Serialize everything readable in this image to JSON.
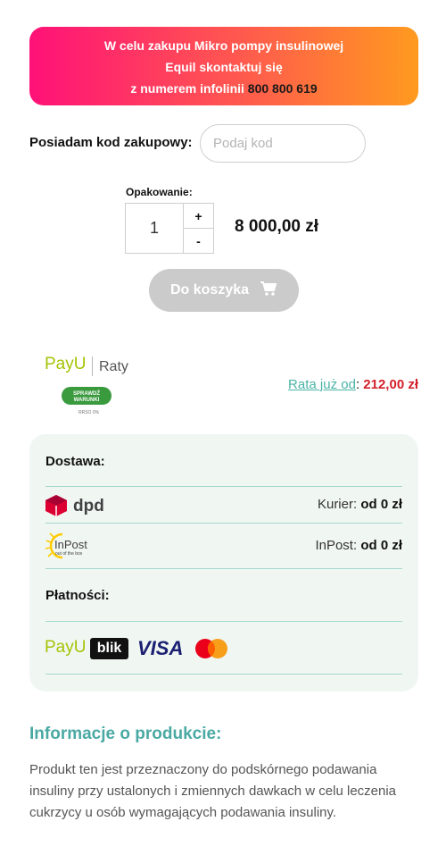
{
  "banner": {
    "line1": "W celu zakupu Mikro pompy insulinowej",
    "line2": "Equil skontaktuj się",
    "line3_prefix": "z numerem infolinii",
    "phone": "800 800 619"
  },
  "purchase_code": {
    "label": "Posiadam kod zakupowy:",
    "placeholder": "Podaj kod",
    "value": ""
  },
  "quantity": {
    "label": "Opakowanie:",
    "value": "1",
    "plus": "+",
    "minus": "-"
  },
  "price": "8 000,00 zł",
  "cart_button": {
    "label": "Do koszyka",
    "icon": "cart-icon"
  },
  "payu_raty": {
    "logo": "PayU",
    "raty": "Raty",
    "check_button": "SPRAWDŹ WARUNKI",
    "rrso": "RRSO 0%",
    "rate_link": "Rata już od",
    "rate_sep": ":",
    "rate_value": "212,00 zł"
  },
  "delivery": {
    "heading": "Dostawa:",
    "carriers": [
      {
        "logo": "dpd",
        "label": "Kurier:",
        "price": "od 0 zł"
      },
      {
        "logo": "InPost",
        "tagline": "out of the box",
        "label": "InPost:",
        "price": "od 0 zł"
      }
    ]
  },
  "payments": {
    "heading": "Płatności:",
    "methods": [
      "PayU",
      "blik",
      "VISA",
      "mastercard"
    ]
  },
  "product_info": {
    "title": "Informacje o produkcie:",
    "text": "Produkt ten jest przeznaczony do podskórnego podawania insuliny przy ustalonych i zmiennych dawkach w celu leczenia cukrzycy u osób wymagających podawania insuliny."
  },
  "colors": {
    "banner_start": "#ff1178",
    "banner_end": "#ff9a1e",
    "accent_teal": "#4ba9a4",
    "rate_red": "#d4202a",
    "payu_green": "#a6c307",
    "panel_bg": "#f0f7f3"
  }
}
